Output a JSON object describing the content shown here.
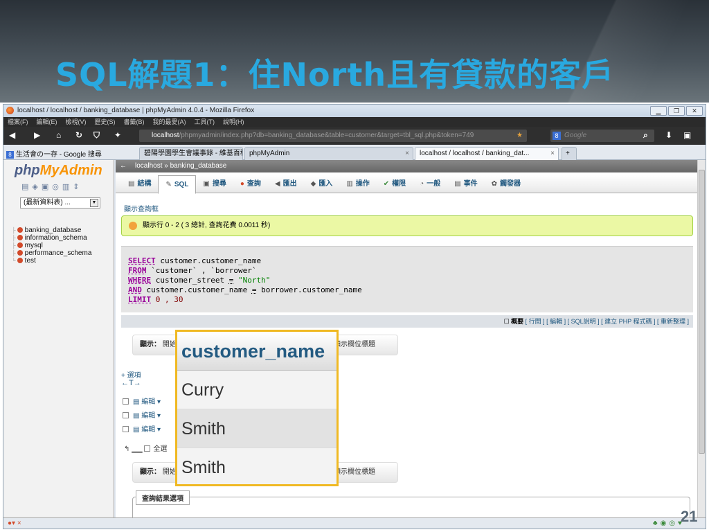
{
  "slide": {
    "title": "SQL解題1：住North且有貸款的客戶",
    "page_number": "21"
  },
  "browser": {
    "window_title": "localhost / localhost / banking_database | phpMyAdmin 4.0.4 - Mozilla Firefox",
    "menu": [
      "檔案(F)",
      "編輯(E)",
      "檢視(V)",
      "歷史(S)",
      "書籤(B)",
      "我的最愛(A)",
      "工具(T)",
      "說明(H)"
    ],
    "url_host": "localhost",
    "url_rest": "/phpmyadmin/index.php?db=banking_database&table=customer&target=tbl_sql.php&token=749",
    "search_placeholder": "Google",
    "bookmark": "生活會の一存 - Google 搜尋",
    "tabs": [
      {
        "label": "碧陽學園學生會議事錄 - 維基百科，..."
      },
      {
        "label": "phpMyAdmin"
      },
      {
        "label": "localhost / localhost / banking_dat..."
      }
    ]
  },
  "sidebar": {
    "logo_php": "php",
    "logo_admin": "MyAdmin",
    "recent_label": "(最新資料表) ...",
    "databases": [
      "banking_database",
      "information_schema",
      "mysql",
      "performance_schema",
      "test"
    ]
  },
  "main": {
    "breadcrumb": "localhost » banking_database",
    "menu": [
      {
        "label": "結構",
        "icon": "▤"
      },
      {
        "label": "SQL",
        "icon": "✎"
      },
      {
        "label": "搜尋",
        "icon": "▣"
      },
      {
        "label": "查詢",
        "icon": "●"
      },
      {
        "label": "匯出",
        "icon": "◀"
      },
      {
        "label": "匯入",
        "icon": "◆"
      },
      {
        "label": "操作",
        "icon": "▥"
      },
      {
        "label": "權限",
        "icon": "✔"
      },
      {
        "label": "一般",
        "icon": "◔"
      },
      {
        "label": "事件",
        "icon": "▤"
      },
      {
        "label": "觸發器",
        "icon": "✿"
      }
    ],
    "show_query_box": "顯示查詢框",
    "success_message": "顯示行 0 - 2 ( 3 總計, 查詢花費 0.0011 秒)",
    "sql": {
      "kw_select": "SELECT",
      "line1": " customer.customer_name",
      "kw_from": "FROM",
      "line2": " `customer` , `borrower`",
      "kw_where": "WHERE",
      "line3_a": " customer_street ",
      "line3_eq": "=",
      "line3_str": " \"North\"",
      "kw_and": "AND",
      "line4_a": " customer.customer_name ",
      "line4_eq": "=",
      "line4_b": " borrower.customer_name",
      "kw_limit": "LIMIT",
      "line5": " 0 , 30"
    },
    "sql_links_bold": "概要",
    "sql_links": "[ 行間 ] [ 編輯 ] [ SQL說明 ] [ 建立 PHP 程式碼 ] [ 重新整理 ]",
    "show_label": "顯示：",
    "show_start": "開始",
    "show_header_text": "顯示欄位標題",
    "options_link": "+ 選項",
    "arrows": "←T→",
    "row_edit": "編輯",
    "select_all": "全選",
    "result_options": "查詢結果選項"
  },
  "result_table": {
    "header": "customer_name",
    "rows": [
      "Curry",
      "Smith",
      "Smith"
    ]
  }
}
